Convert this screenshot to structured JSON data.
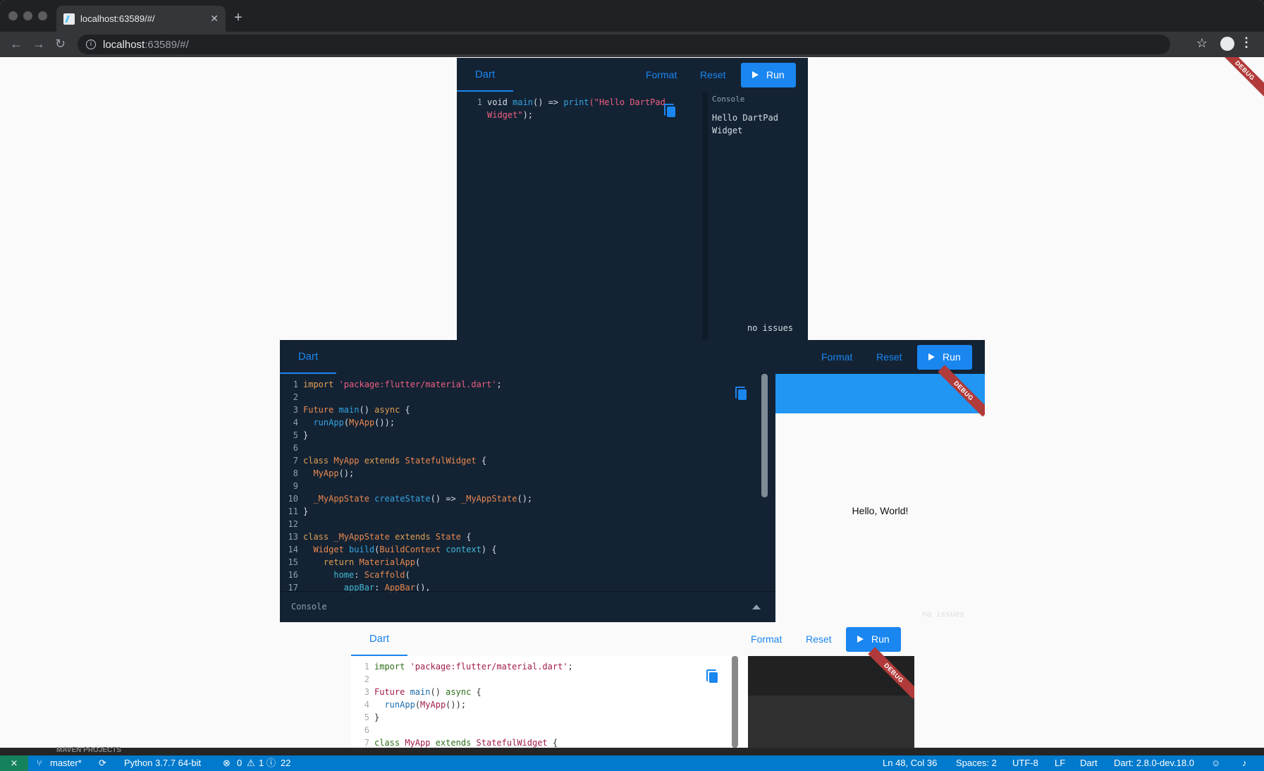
{
  "browser": {
    "tab_title": "localhost:63589/#/",
    "url_host": "localhost",
    "url_rest": ":63589/#/"
  },
  "debug_label": "DEBUG",
  "pad1": {
    "tab": "Dart",
    "format": "Format",
    "reset": "Reset",
    "run": "Run",
    "console_title": "Console",
    "console_output_1": "Hello DartPad",
    "console_output_2": "Widget",
    "issues": "no issues"
  },
  "pad2": {
    "tab": "Dart",
    "format": "Format",
    "reset": "Reset",
    "run": "Run",
    "console_title": "Console",
    "preview_text": "Hello, World!",
    "issues": "no issues"
  },
  "pad3": {
    "tab": "Dart",
    "format": "Format",
    "reset": "Reset",
    "run": "Run"
  },
  "vscode": {
    "maven": "MAVEN PROJECTS",
    "branch": "master*",
    "python": "Python 3.7.7 64-bit",
    "errors": "0",
    "warnings": "1",
    "infos": "22",
    "position": "Ln 48, Col 36",
    "spaces": "Spaces: 2",
    "encoding": "UTF-8",
    "eol": "LF",
    "language": "Dart",
    "sdk": "Dart: 2.8.0-dev.18.0"
  },
  "colors": {
    "accent": "#1a86f0",
    "editor_bg": "#132334",
    "status_bar": "#007acc",
    "ribbon": "#b13a3a"
  }
}
